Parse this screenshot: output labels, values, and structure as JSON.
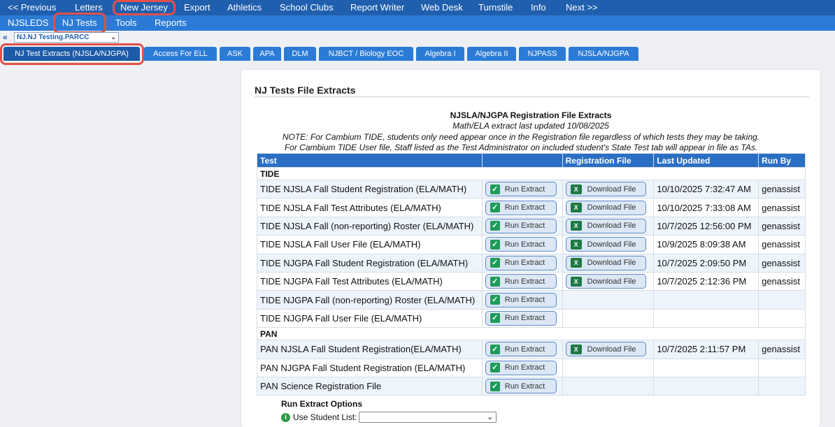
{
  "top_nav": {
    "items": [
      "<< Previous",
      "Letters",
      "New Jersey",
      "Export",
      "Athletics",
      "School Clubs",
      "Report Writer",
      "Web Desk",
      "Turnstile",
      "Info",
      "Next >>"
    ]
  },
  "sub_nav": {
    "items": [
      "NJSLEDS",
      "NJ Tests",
      "Tools",
      "Reports"
    ]
  },
  "selector": {
    "back_arrows": "«",
    "value": "NJ.NJ Testing.PARCC"
  },
  "tabs": [
    "NJ Test Extracts (NJSLA/NJGPA)",
    "Access For ELL",
    "ASK",
    "APA",
    "DLM",
    "NJBCT / Biology EOC",
    "Algebra I",
    "Algebra II",
    "NJPASS",
    "NJSLA/NJGPA"
  ],
  "panel": {
    "title": "NJ Tests File Extracts",
    "heading": "NJSLA/NJGPA Registration File Extracts",
    "subheading": "Math/ELA extract last updated 10/08/2025",
    "note1": "NOTE: For Cambium TIDE, students only need appear once in the Registration file regardless of which tests they may be taking.",
    "note2": "For Cambium TIDE User file, Staff listed as the Test Administrator on included student's State Test tab will appear in file as TAs."
  },
  "table": {
    "headers": [
      "Test",
      "",
      "Registration File",
      "Last Updated",
      "Run By"
    ],
    "run_label": "Run Extract",
    "download_label": "Download File",
    "sections": [
      {
        "name": "TIDE",
        "rows": [
          {
            "test": "TIDE NJSLA Fall Student Registration (ELA/MATH)",
            "download": true,
            "updated": "10/10/2025 7:32:47 AM",
            "run_by": "genassist"
          },
          {
            "test": "TIDE NJSLA Fall Test Attributes (ELA/MATH)",
            "download": true,
            "updated": "10/10/2025 7:33:08 AM",
            "run_by": "genassist"
          },
          {
            "test": "TIDE NJSLA Fall (non-reporting) Roster (ELA/MATH)",
            "download": true,
            "updated": "10/7/2025 12:56:00 PM",
            "run_by": "genassist"
          },
          {
            "test": "TIDE NJSLA Fall User File (ELA/MATH)",
            "download": true,
            "updated": "10/9/2025 8:09:38 AM",
            "run_by": "genassist"
          },
          {
            "test": "TIDE NJGPA Fall Student Registration (ELA/MATH)",
            "download": true,
            "updated": "10/7/2025 2:09:50 PM",
            "run_by": "genassist"
          },
          {
            "test": "TIDE NJGPA Fall Test Attributes (ELA/MATH)",
            "download": true,
            "updated": "10/7/2025 2:12:36 PM",
            "run_by": "genassist"
          },
          {
            "test": "TIDE NJGPA Fall (non-reporting) Roster (ELA/MATH)",
            "download": false,
            "updated": "",
            "run_by": ""
          },
          {
            "test": "TIDE NJGPA Fall User File (ELA/MATH)",
            "download": false,
            "updated": "",
            "run_by": ""
          }
        ]
      },
      {
        "name": "PAN",
        "rows": [
          {
            "test": "PAN NJSLA Fall Student Registration(ELA/MATH)",
            "download": true,
            "updated": "10/7/2025 2:11:57 PM",
            "run_by": "genassist"
          },
          {
            "test": "PAN NJGPA Fall Student Registration (ELA/MATH)",
            "download": false,
            "updated": "",
            "run_by": ""
          },
          {
            "test": "PAN Science Registration File",
            "download": false,
            "updated": "",
            "run_by": ""
          }
        ]
      }
    ]
  },
  "options": {
    "title": "Run Extract Options",
    "student_list_label": "Use Student List:",
    "student_list_value": ""
  },
  "colors": {
    "top_nav": "#1f5fae",
    "sub_nav": "#2b7bd6",
    "highlight": "#e2504a",
    "table_header": "#2b6fc4"
  }
}
